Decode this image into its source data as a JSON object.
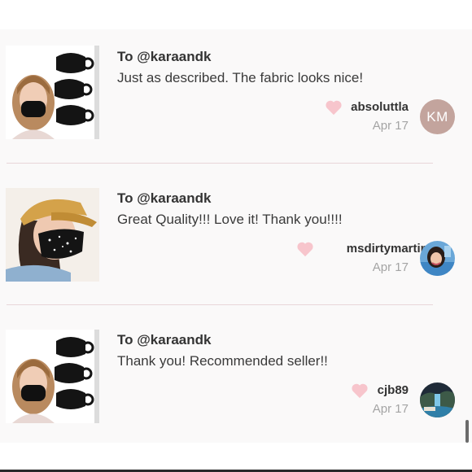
{
  "comments": [
    {
      "to_label": "To @karaandk",
      "message": "Just as described. The fabric looks nice!",
      "username": "absoluttla",
      "date": "Apr 17",
      "avatar_initials": "KM",
      "avatar_color": "#c3a49d",
      "thumbnail": "woman-wearing-black-mask-with-three-masks"
    },
    {
      "to_label": "To @karaandk",
      "message": "Great Quality!!! Love it! Thank you!!!!",
      "username": "msdirtymartini",
      "date": "Apr 17",
      "thumbnail": "woman-in-yellow-cap-with-star-mask"
    },
    {
      "to_label": "To @karaandk",
      "message": "Thank you! Recommended seller!!",
      "username": "cjb89",
      "date": "Apr 17",
      "thumbnail": "woman-wearing-black-mask-with-three-masks"
    }
  ],
  "colors": {
    "heart": "#f7c5cc",
    "divider": "#e8d6d9",
    "date_text": "#a4a4a4"
  }
}
